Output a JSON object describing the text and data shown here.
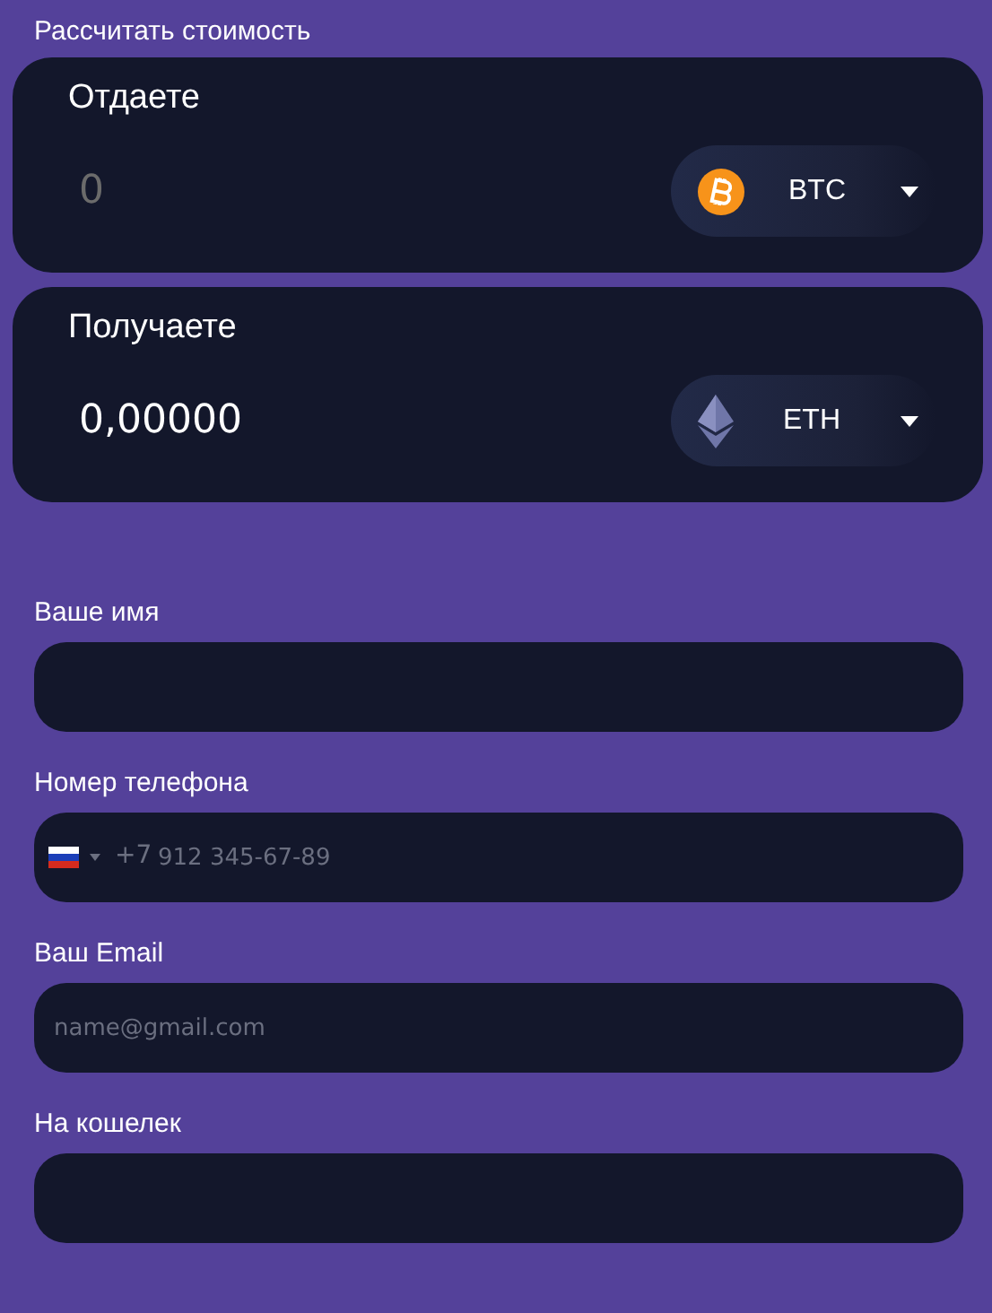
{
  "title": "Рассчитать стоимость",
  "exchange": [
    {
      "label": "Отдаете",
      "placeholder": "0",
      "currency": {
        "code": "BTC",
        "kind": "btc"
      }
    },
    {
      "label": "Получаете",
      "value": "0,00000",
      "currency": {
        "code": "ETH",
        "kind": "eth"
      }
    }
  ],
  "fields": [
    {
      "kind": "text",
      "label": "Ваше имя"
    },
    {
      "kind": "phone",
      "label": "Номер телефона",
      "dial_code": "+7",
      "placeholder": "912 345-67-89"
    },
    {
      "kind": "email",
      "label": "Ваш Email",
      "placeholder": "name@gmail.com"
    },
    {
      "kind": "text",
      "label": "На кошелек"
    }
  ]
}
